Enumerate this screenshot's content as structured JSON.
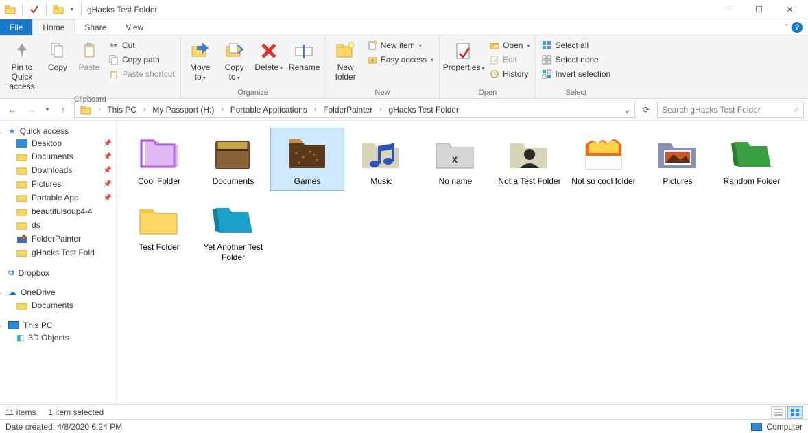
{
  "window": {
    "title": "gHacks Test Folder"
  },
  "tabs": {
    "file": "File",
    "home": "Home",
    "share": "Share",
    "view": "View"
  },
  "ribbon": {
    "clipboard": {
      "label": "Clipboard",
      "pin": "Pin to Quick access",
      "copy": "Copy",
      "paste": "Paste",
      "cut": "Cut",
      "copy_path": "Copy path",
      "paste_shortcut": "Paste shortcut"
    },
    "organize": {
      "label": "Organize",
      "move_to": "Move to",
      "copy_to": "Copy to",
      "delete": "Delete",
      "rename": "Rename"
    },
    "new": {
      "label": "New",
      "new_folder": "New folder",
      "new_item": "New item",
      "easy_access": "Easy access"
    },
    "open": {
      "label": "Open",
      "properties": "Properties",
      "open": "Open",
      "edit": "Edit",
      "history": "History"
    },
    "select": {
      "label": "Select",
      "select_all": "Select all",
      "select_none": "Select none",
      "invert": "Invert selection"
    }
  },
  "breadcrumb": {
    "items": [
      "This PC",
      "My Passport (H:)",
      "Portable Applications",
      "FolderPainter",
      "gHacks Test Folder"
    ]
  },
  "search": {
    "placeholder": "Search gHacks Test Folder"
  },
  "sidebar": {
    "quick_access": "Quick access",
    "desktop": "Desktop",
    "documents": "Documents",
    "downloads": "Downloads",
    "pictures": "Pictures",
    "portable_app": "Portable App",
    "beautifulsoup": "beautifulsoup4-4",
    "ds": "ds",
    "folderpainter": "FolderPainter",
    "ghacks": "gHacks Test Fold",
    "dropbox": "Dropbox",
    "onedrive": "OneDrive",
    "od_documents": "Documents",
    "this_pc": "This PC",
    "objects3d": "3D Objects"
  },
  "folders": [
    {
      "name": "Cool Folder",
      "style": "purple"
    },
    {
      "name": "Documents",
      "style": "brown-leather"
    },
    {
      "name": "Games",
      "style": "lv-brown",
      "selected": true
    },
    {
      "name": "Music",
      "style": "music"
    },
    {
      "name": "No name",
      "style": "osx"
    },
    {
      "name": "Not a Test Folder",
      "style": "person"
    },
    {
      "name": "Not so cool folder",
      "style": "fire"
    },
    {
      "name": "Pictures",
      "style": "photo"
    },
    {
      "name": "Random Folder",
      "style": "green"
    },
    {
      "name": "Test Folder",
      "style": "plain"
    },
    {
      "name": "Yet Another Test Folder",
      "style": "teal"
    }
  ],
  "status": {
    "count": "11 items",
    "selected": "1 item selected",
    "date_created": "Date created: 4/8/2020 6:24 PM",
    "computer": "Computer"
  }
}
